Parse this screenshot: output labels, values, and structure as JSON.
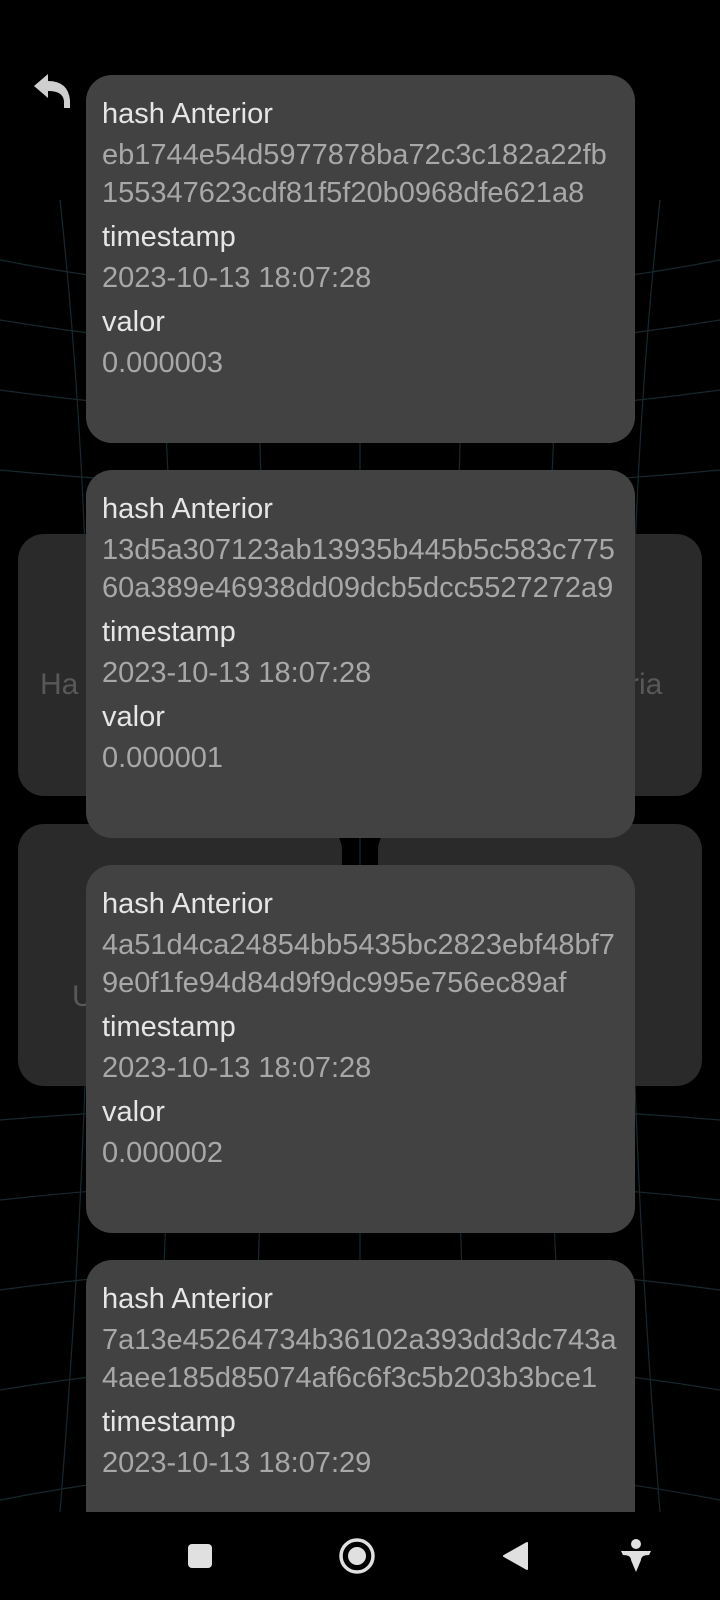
{
  "colors": {
    "background": "#000000",
    "card": "#424242",
    "tile": "#2a2a2a",
    "label_text": "#e6e6e6",
    "value_text": "#a8a8a8",
    "grid": "#1b2d33"
  },
  "header": {
    "back_icon": "back-arrow-icon"
  },
  "menu": {
    "tiles": [
      {
        "label_left_fragment": "Ha",
        "label_right_fragment": "ria"
      },
      {
        "label_left_fragment": "U"
      }
    ]
  },
  "blocks": [
    {
      "hash_label": "hash Anterior",
      "hash": "eb1744e54d5977878ba72c3c182a22fb155347623cdf81f5f20b0968dfe621a8",
      "timestamp_label": "timestamp",
      "timestamp": "2023-10-13 18:07:28",
      "valor_label": "valor",
      "valor": "0.000003"
    },
    {
      "hash_label": "hash Anterior",
      "hash": "13d5a307123ab13935b445b5c583c77560a389e46938dd09dcb5dcc5527272a9",
      "timestamp_label": "timestamp",
      "timestamp": "2023-10-13 18:07:28",
      "valor_label": "valor",
      "valor": "0.000001"
    },
    {
      "hash_label": "hash Anterior",
      "hash": "4a51d4ca24854bb5435bc2823ebf48bf79e0f1fe94d84d9f9dc995e756ec89af",
      "timestamp_label": "timestamp",
      "timestamp": "2023-10-13 18:07:28",
      "valor_label": "valor",
      "valor": "0.000002"
    },
    {
      "hash_label": "hash Anterior",
      "hash": "7a13e45264734b36102a393dd3dc743a4aee185d85074af6c6f3c5b203b3bce1",
      "timestamp_label": "timestamp",
      "timestamp": "2023-10-13 18:07:29"
    }
  ],
  "navbar": {
    "icons": [
      "recent-apps-icon",
      "home-icon",
      "back-icon",
      "accessibility-icon"
    ]
  }
}
